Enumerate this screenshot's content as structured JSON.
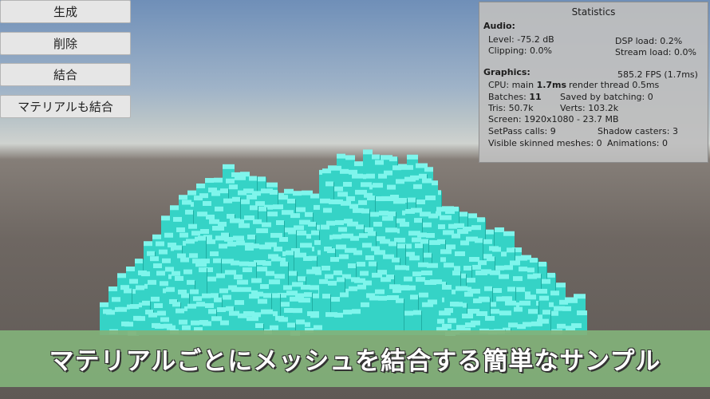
{
  "buttons": {
    "generate": "生成",
    "delete": "削除",
    "combine": "結合",
    "combine_materials": "マテリアルも結合"
  },
  "stats": {
    "title": "Statistics",
    "audio_label": "Audio:",
    "level": "Level: -75.2 dB",
    "dsp_load": "DSP load: 0.2%",
    "clipping": "Clipping: 0.0%",
    "stream_load": "Stream load: 0.0%",
    "graphics_label": "Graphics:",
    "fps": "585.2 FPS (1.7ms)",
    "cpu_prefix": "CPU: main ",
    "cpu_main": "1.7ms",
    "render_thread": "render thread 0.5ms",
    "batches_prefix": "Batches: ",
    "batches_value": "11",
    "saved_by_batching": "Saved by batching: 0",
    "tris": "Tris: 50.7k",
    "verts": "Verts: 103.2k",
    "screen": "Screen: 1920x1080 - 23.7 MB",
    "setpass": "SetPass calls: 9",
    "shadow_casters": "Shadow casters: 3",
    "visible_skinned": "Visible skinned meshes: 0",
    "animations": "Animations: 0"
  },
  "caption": "マテリアルごとにメッシュを結合する簡単なサンプル",
  "colors": {
    "block_top": "#7ff5ec",
    "block_front": "#35d3c6",
    "block_side": "#1faea3",
    "banner": "#82b27a"
  }
}
